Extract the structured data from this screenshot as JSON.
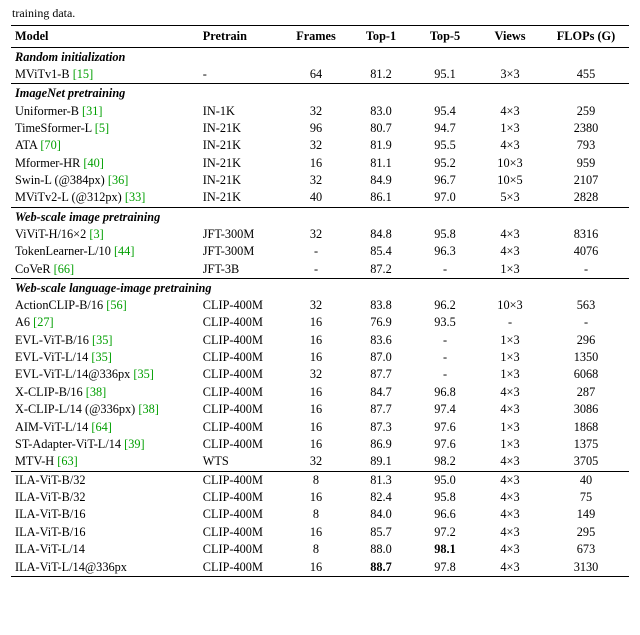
{
  "caption_fragment": "training data.",
  "headers": {
    "model": "Model",
    "pretrain": "Pretrain",
    "frames": "Frames",
    "top1": "Top-1",
    "top5": "Top-5",
    "views": "Views",
    "flops": "FLOPs (G)"
  },
  "groups": [
    {
      "title": "Random initialization",
      "rows": [
        {
          "model": "MViTv1-B",
          "cite": "[15]",
          "pretrain": "-",
          "frames": "64",
          "top1": "81.2",
          "top5": "95.1",
          "views": "3×3",
          "flops": "455"
        }
      ]
    },
    {
      "title": "ImageNet pretraining",
      "rows": [
        {
          "model": "Uniformer-B",
          "cite": "[31]",
          "pretrain": "IN-1K",
          "frames": "32",
          "top1": "83.0",
          "top5": "95.4",
          "views": "4×3",
          "flops": "259"
        },
        {
          "model": "TimeSformer-L",
          "cite": "[5]",
          "pretrain": "IN-21K",
          "frames": "96",
          "top1": "80.7",
          "top5": "94.7",
          "views": "1×3",
          "flops": "2380"
        },
        {
          "model": "ATA",
          "cite": "[70]",
          "pretrain": "IN-21K",
          "frames": "32",
          "top1": "81.9",
          "top5": "95.5",
          "views": "4×3",
          "flops": "793"
        },
        {
          "model": "Mformer-HR",
          "cite": "[40]",
          "pretrain": "IN-21K",
          "frames": "16",
          "top1": "81.1",
          "top5": "95.2",
          "views": "10×3",
          "flops": "959"
        },
        {
          "model": "Swin-L (@384px)",
          "cite": "[36]",
          "pretrain": "IN-21K",
          "frames": "32",
          "top1": "84.9",
          "top5": "96.7",
          "views": "10×5",
          "flops": "2107"
        },
        {
          "model": "MViTv2-L (@312px)",
          "cite": "[33]",
          "pretrain": "IN-21K",
          "frames": "40",
          "top1": "86.1",
          "top5": "97.0",
          "views": "5×3",
          "flops": "2828"
        }
      ]
    },
    {
      "title": "Web-scale image pretraining",
      "rows": [
        {
          "model": "ViViT-H/16×2",
          "cite": "[3]",
          "pretrain": "JFT-300M",
          "frames": "32",
          "top1": "84.8",
          "top5": "95.8",
          "views": "4×3",
          "flops": "8316"
        },
        {
          "model": "TokenLearner-L/10",
          "cite": "[44]",
          "pretrain": "JFT-300M",
          "frames": "-",
          "top1": "85.4",
          "top5": "96.3",
          "views": "4×3",
          "flops": "4076"
        },
        {
          "model": "CoVeR",
          "cite": "[66]",
          "pretrain": "JFT-3B",
          "frames": "-",
          "top1": "87.2",
          "top5": "-",
          "views": "1×3",
          "flops": "-"
        }
      ]
    },
    {
      "title": "Web-scale language-image pretraining",
      "rows": [
        {
          "model": "ActionCLIP-B/16",
          "cite": "[56]",
          "pretrain": "CLIP-400M",
          "frames": "32",
          "top1": "83.8",
          "top5": "96.2",
          "views": "10×3",
          "flops": "563"
        },
        {
          "model": "A6",
          "cite": "[27]",
          "pretrain": "CLIP-400M",
          "frames": "16",
          "top1": "76.9",
          "top5": "93.5",
          "views": "-",
          "flops": "-"
        },
        {
          "model": "EVL-ViT-B/16",
          "cite": "[35]",
          "pretrain": "CLIP-400M",
          "frames": "16",
          "top1": "83.6",
          "top5": "-",
          "views": "1×3",
          "flops": "296"
        },
        {
          "model": "EVL-ViT-L/14",
          "cite": "[35]",
          "pretrain": "CLIP-400M",
          "frames": "16",
          "top1": "87.0",
          "top5": "-",
          "views": "1×3",
          "flops": "1350"
        },
        {
          "model": "EVL-ViT-L/14@336px",
          "cite": "[35]",
          "pretrain": "CLIP-400M",
          "frames": "32",
          "top1": "87.7",
          "top5": "-",
          "views": "1×3",
          "flops": "6068"
        },
        {
          "model": "X-CLIP-B/16",
          "cite": "[38]",
          "pretrain": "CLIP-400M",
          "frames": "16",
          "top1": "84.7",
          "top5": "96.8",
          "views": "4×3",
          "flops": "287"
        },
        {
          "model": "X-CLIP-L/14 (@336px)",
          "cite": "[38]",
          "pretrain": "CLIP-400M",
          "frames": "16",
          "top1": "87.7",
          "top5": "97.4",
          "views": "4×3",
          "flops": "3086"
        },
        {
          "model": "AIM-ViT-L/14",
          "cite": "[64]",
          "pretrain": "CLIP-400M",
          "frames": "16",
          "top1": "87.3",
          "top5": "97.6",
          "views": "1×3",
          "flops": "1868"
        },
        {
          "model": "ST-Adapter-ViT-L/14",
          "cite": "[39]",
          "pretrain": "CLIP-400M",
          "frames": "16",
          "top1": "86.9",
          "top5": "97.6",
          "views": "1×3",
          "flops": "1375"
        },
        {
          "model": "MTV-H",
          "cite": "[63]",
          "pretrain": "WTS",
          "frames": "32",
          "top1": "89.1",
          "top5": "98.2",
          "views": "4×3",
          "flops": "3705"
        }
      ]
    },
    {
      "title": "",
      "rows": [
        {
          "model": "ILA-ViT-B/32",
          "cite": "",
          "pretrain": "CLIP-400M",
          "frames": "8",
          "top1": "81.3",
          "top5": "95.0",
          "views": "4×3",
          "flops": "40"
        },
        {
          "model": "ILA-ViT-B/32",
          "cite": "",
          "pretrain": "CLIP-400M",
          "frames": "16",
          "top1": "82.4",
          "top5": "95.8",
          "views": "4×3",
          "flops": "75"
        },
        {
          "model": "ILA-ViT-B/16",
          "cite": "",
          "pretrain": "CLIP-400M",
          "frames": "8",
          "top1": "84.0",
          "top5": "96.6",
          "views": "4×3",
          "flops": "149"
        },
        {
          "model": "ILA-ViT-B/16",
          "cite": "",
          "pretrain": "CLIP-400M",
          "frames": "16",
          "top1": "85.7",
          "top5": "97.2",
          "views": "4×3",
          "flops": "295"
        },
        {
          "model": "ILA-ViT-L/14",
          "cite": "",
          "pretrain": "CLIP-400M",
          "frames": "8",
          "top1": "88.0",
          "top5": "98.1",
          "top5_bold": true,
          "views": "4×3",
          "flops": "673"
        },
        {
          "model": "ILA-ViT-L/14@336px",
          "cite": "",
          "pretrain": "CLIP-400M",
          "frames": "16",
          "top1": "88.7",
          "top1_bold": true,
          "top5": "97.8",
          "views": "4×3",
          "flops": "3130"
        }
      ]
    }
  ]
}
